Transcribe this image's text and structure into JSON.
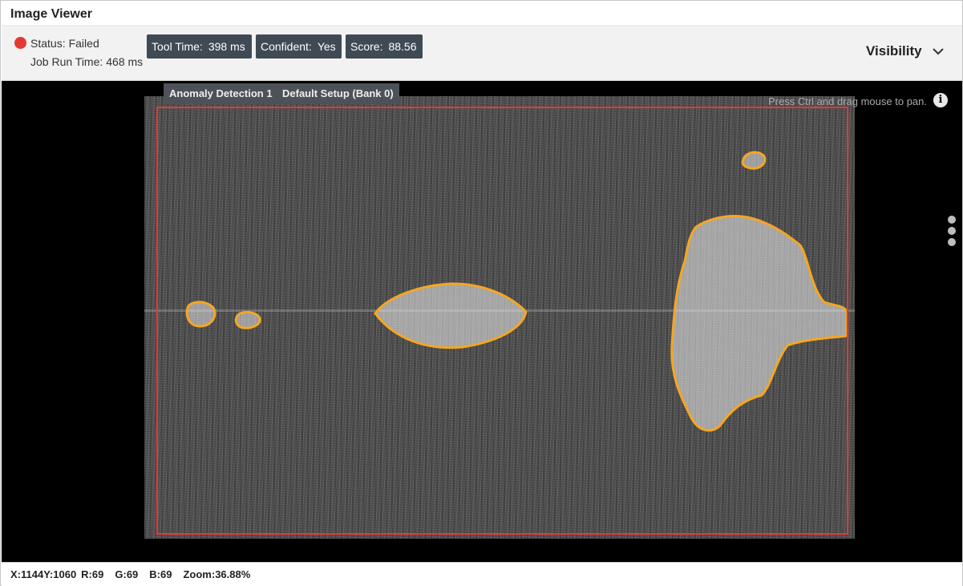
{
  "window": {
    "title": "Image Viewer"
  },
  "status": {
    "label": "Status:",
    "value": "Failed",
    "color": "#e53935",
    "job_run_label": "Job Run Time:",
    "job_run_value": "468 ms"
  },
  "metrics": [
    {
      "label": "Tool Time:",
      "value": "398 ms"
    },
    {
      "label": "Confident:",
      "value": "Yes"
    },
    {
      "label": "Score:",
      "value": "88.56"
    }
  ],
  "visibility": {
    "label": "Visibility",
    "icon": "chevron-down-icon"
  },
  "viewer": {
    "tabs": [
      "Anomaly Detection 1",
      "Default Setup (Bank 0)"
    ],
    "hint": "Press Ctrl and drag mouse to pan.",
    "info_icon": "info-icon",
    "more_icon": "kebab-menu-icon",
    "roi_color": "#e53935",
    "anomaly_outline_color": "#f5a623"
  },
  "readout": {
    "x_label": "X:",
    "x": "1144",
    "y_label": "Y:",
    "y": "1060",
    "r_label": "R:",
    "r": "69",
    "g_label": "G:",
    "g": "69",
    "b_label": "B:",
    "b": "69",
    "zoom_label": "Zoom:",
    "zoom": "36.88%"
  }
}
